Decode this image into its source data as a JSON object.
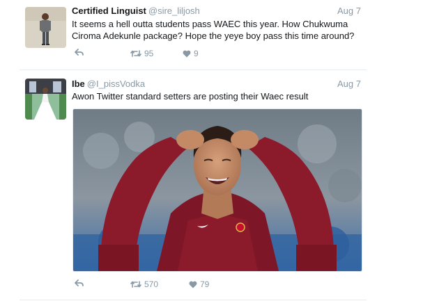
{
  "tweets": [
    {
      "name": "Certified Linguist",
      "handle": "@sire_liljosh",
      "date": "Aug 7",
      "text": "It seems a hell outta students pass WAEC this year. How Chukwuma Ciroma Adekunle package? Hope the yeye boy pass this time around?",
      "retweets": "95",
      "likes": "9"
    },
    {
      "name": "Ibe",
      "handle": "@I_pissVodka",
      "date": "Aug 7",
      "text": "Awon Twitter standard setters are posting their Waec result",
      "retweets": "570",
      "likes": "79"
    }
  ],
  "icons": {
    "reply": "reply-icon",
    "retweet": "retweet-icon",
    "like": "heart-icon"
  },
  "colors": {
    "muted": "#8899a6",
    "text": "#14171a",
    "divider": "#e6ecf0",
    "jersey": "#8b1a2b"
  }
}
